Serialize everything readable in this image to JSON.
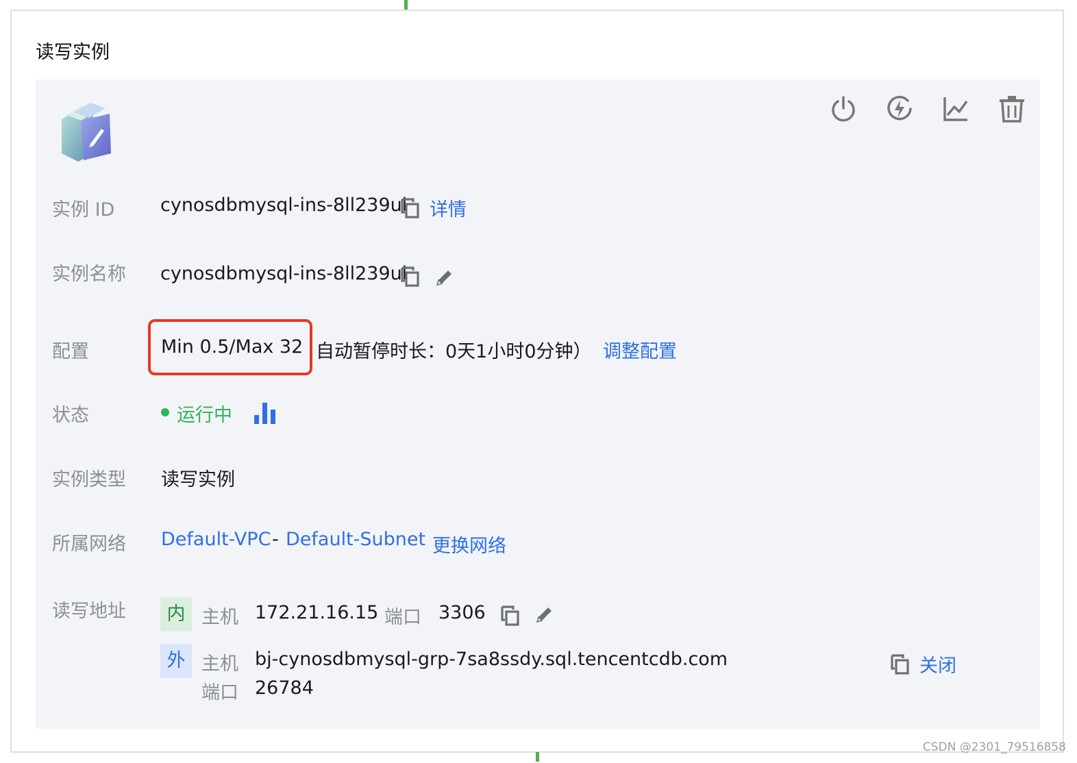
{
  "section_title": "读写实例",
  "icons": {
    "database": "database-edit-icon",
    "toolbar": [
      "power-icon",
      "speed-icon",
      "line-chart-icon",
      "trash-icon"
    ],
    "copy": "copy-icon",
    "edit": "pencil-icon",
    "monitor": "bar-chart-icon"
  },
  "colors": {
    "link": "#2f6fe8",
    "status_running": "#2fb55a",
    "highlight_border": "#e53a26",
    "label": "#8a8f99"
  },
  "rows": {
    "instance_id": {
      "label": "实例 ID",
      "value": "cynosdbmysql-ins-8ll239ul",
      "link": "详情"
    },
    "instance_name": {
      "label": "实例名称",
      "value": "cynosdbmysql-ins-8ll239ul"
    },
    "config": {
      "label": "配置",
      "value": "Min 0.5/Max 32",
      "extra": "自动暂停时长：0天1小时0分钟）",
      "link": "调整配置"
    },
    "status": {
      "label": "状态",
      "value": "运行中"
    },
    "instance_type": {
      "label": "实例类型",
      "value": "读写实例"
    },
    "network": {
      "label": "所属网络",
      "vpc": "Default-VPC",
      "separator": "-",
      "subnet": "Default-Subnet",
      "link": "更换网络"
    },
    "address": {
      "label": "读写地址",
      "internal": {
        "tag": "内",
        "host_label": "主机",
        "host": "172.21.16.15",
        "port_label": "端口",
        "port": "3306"
      },
      "external": {
        "tag": "外",
        "host_label": "主机",
        "host": "bj-cynosdbmysql-grp-7sa8ssdy.sql.tencentcdb.com",
        "port_label": "端口",
        "port": "26784",
        "action": "关闭"
      }
    }
  },
  "watermark": "CSDN @2301_79516858"
}
